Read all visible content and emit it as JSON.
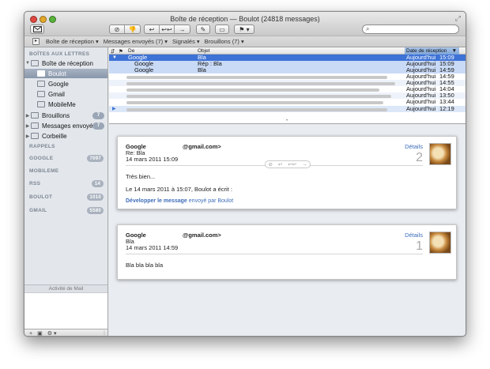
{
  "window": {
    "title": "Boîte de réception — Boulot (24818 messages)"
  },
  "toolbar": {
    "compose_icon": "envelope-icon",
    "buttons": [
      "⊘",
      "👎",
      "↩",
      "↩↩",
      "→",
      "✎",
      "▭",
      "⚑ ▾"
    ],
    "search_placeholder": ""
  },
  "favorites": {
    "items": [
      "Boîte de réception ▾",
      "Messages envoyés (7) ▾",
      "Signalés ▾",
      "Brouillons (7) ▾"
    ]
  },
  "sidebar": {
    "mailboxes_header": "BOÎTES AUX LETTRES",
    "inbox_label": "Boîte de réception",
    "inbox_children": [
      "Boulot",
      "Google",
      "Gmail",
      "MobileMe"
    ],
    "drafts_label": "Brouillons",
    "drafts_count": "7",
    "sent_label": "Messages envoyés",
    "sent_count": "7",
    "trash_label": "Corbeille",
    "rappels_header": "RAPPELS",
    "google_header": "GOOGLE",
    "google_count": "7097",
    "mobileme_header": "MOBILEME",
    "rss_header": "RSS",
    "rss_count": "14",
    "boulot_header": "BOULOT",
    "boulot_count": "1010",
    "gmail_header": "GMAIL",
    "gmail_count": "5580",
    "activity_label": "Activité de Mail",
    "bottom_buttons": [
      "+",
      "▣",
      "⚙ ▾"
    ]
  },
  "message_list": {
    "columns": {
      "from": "De",
      "subject": "Objet",
      "date": "Date de réception"
    },
    "rows": [
      {
        "from": "Google",
        "subject": "Bla",
        "day": "Aujourd'hui",
        "time": "15:09"
      },
      {
        "from": "Google",
        "subject": "Rép : Bla",
        "day": "Aujourd'hui",
        "time": "15:09"
      },
      {
        "from": "Google",
        "subject": "Bla",
        "day": "Aujourd'hui",
        "time": "14:59"
      },
      {
        "from": "",
        "subject": "",
        "day": "Aujourd'hui",
        "time": "14:59"
      },
      {
        "from": "",
        "subject": "",
        "day": "Aujourd'hui",
        "time": "14:55"
      },
      {
        "from": "",
        "subject": "",
        "day": "Aujourd'hui",
        "time": "14:04"
      },
      {
        "from": "",
        "subject": "",
        "day": "Aujourd'hui",
        "time": "13:50"
      },
      {
        "from": "",
        "subject": "",
        "day": "Aujourd'hui",
        "time": "13:44"
      },
      {
        "from": "",
        "subject": "",
        "day": "Aujourd'hui",
        "time": "12:19"
      }
    ]
  },
  "messages": [
    {
      "from": "Google",
      "address": "@gmail.com>",
      "subject": "Re: Bla",
      "date": "14 mars 2011 15:09",
      "details": "Détails",
      "number": "2",
      "body": "Très bien...",
      "quote": "Le 14 mars 2011 à 15:07, Boulot a écrit :",
      "expand_bold": "Développer le message",
      "expand_rest": "envoyé par Boulot"
    },
    {
      "from": "Google",
      "address": "@gmail.com>",
      "subject": "Bla",
      "date": "14 mars 2011 14:59",
      "details": "Détails",
      "number": "1",
      "body": "Bla bla bla bla"
    }
  ]
}
